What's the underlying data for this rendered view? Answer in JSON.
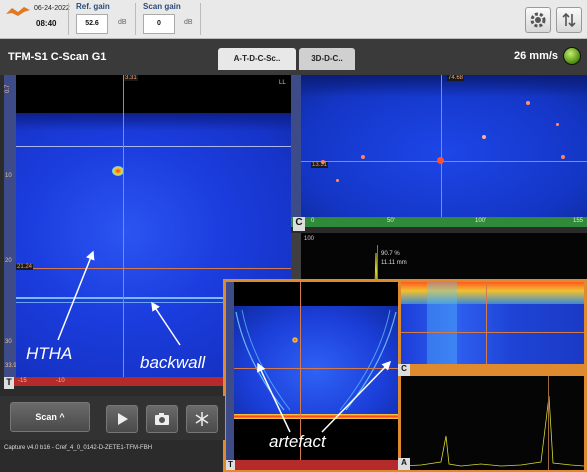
{
  "status": {
    "date": "06-24-2022",
    "time": "08:40"
  },
  "gains": {
    "ref_label": "Ref. gain",
    "ref_value": "52.6",
    "ref_unit": "dB",
    "scan_label": "Scan gain",
    "scan_value": "0",
    "scan_unit": "dB"
  },
  "header": {
    "title": "TFM-S1 C-Scan G1",
    "tabs": [
      "A-T-D-C-Sc..",
      "3D-D-C.."
    ],
    "speed": "26 mm/s"
  },
  "main_scan": {
    "cursor_x_tag": "3.31",
    "cursor_y_tag": "21.24",
    "corner_label": "LL",
    "view_letter": "T",
    "y_ticks": [
      "0.7",
      "10",
      "20",
      "30",
      "33.9"
    ],
    "x_ticks": [
      "-15",
      "-10"
    ]
  },
  "top_right_scan": {
    "cursor_x_tag": "74.68",
    "cursor_y_tag": "13.31",
    "view_letter": "C",
    "x_ticks": [
      "0",
      "50'",
      "100'",
      "155"
    ]
  },
  "ascan": {
    "y_tick": "100",
    "amp": "90.7 %",
    "depth": "11.11 mm"
  },
  "annotations": {
    "htha": "HTHA",
    "backwall": "backwall",
    "artefact": "artefact"
  },
  "inset": {
    "c_letter": "C",
    "a_letter": "A",
    "t_letter": "T"
  },
  "controls": {
    "scan_label": "Scan ^"
  },
  "footer": "Capture v4.0 b16 - Cref_4_0_0142-D-ZETE1-TFM-FBH",
  "colors": {
    "scan_blue": "#1a3fd4",
    "cursor": "#d57a4a",
    "inset_border": "#e08a30"
  }
}
